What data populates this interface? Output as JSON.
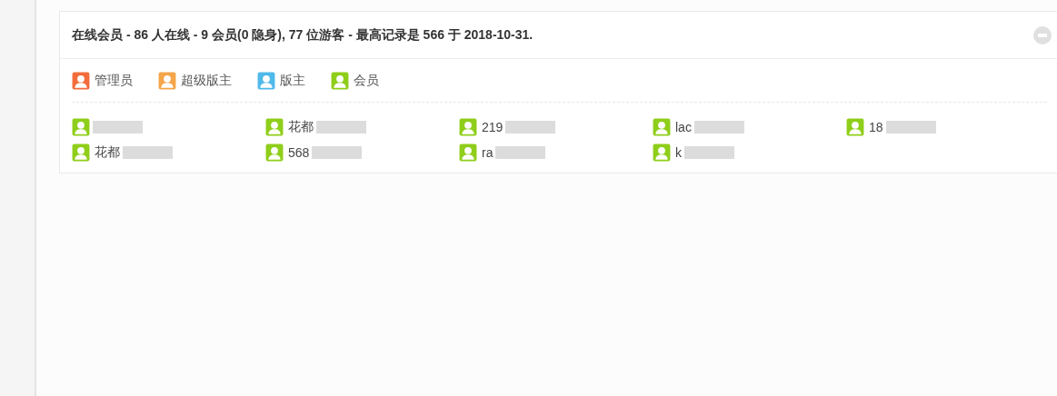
{
  "panel": {
    "title": "在线会员 - 86 人在线 - 9 会员(0 隐身), 77 位游客 - 最高记录是 566 于 2018-10-31.",
    "collapsed": false
  },
  "legend": [
    {
      "label": "管理员",
      "color": "#f26c3b"
    },
    {
      "label": "超级版主",
      "color": "#f5a54a"
    },
    {
      "label": "版主",
      "color": "#4fb9ea"
    },
    {
      "label": "会员",
      "color": "#8fce1a"
    }
  ],
  "members": [
    {
      "color": "#8fce1a"
    },
    {
      "name": "花都",
      "color": "#8fce1a"
    },
    {
      "name": "219",
      "color": "#8fce1a"
    },
    {
      "name": "lac",
      "color": "#8fce1a"
    },
    {
      "name": "18",
      "color": "#8fce1a"
    },
    {
      "name": "花都",
      "color": "#8fce1a"
    },
    {
      "name": "568",
      "color": "#8fce1a"
    },
    {
      "name": "ra",
      "color": "#8fce1a"
    },
    {
      "name": "k",
      "color": "#8fce1a"
    }
  ]
}
